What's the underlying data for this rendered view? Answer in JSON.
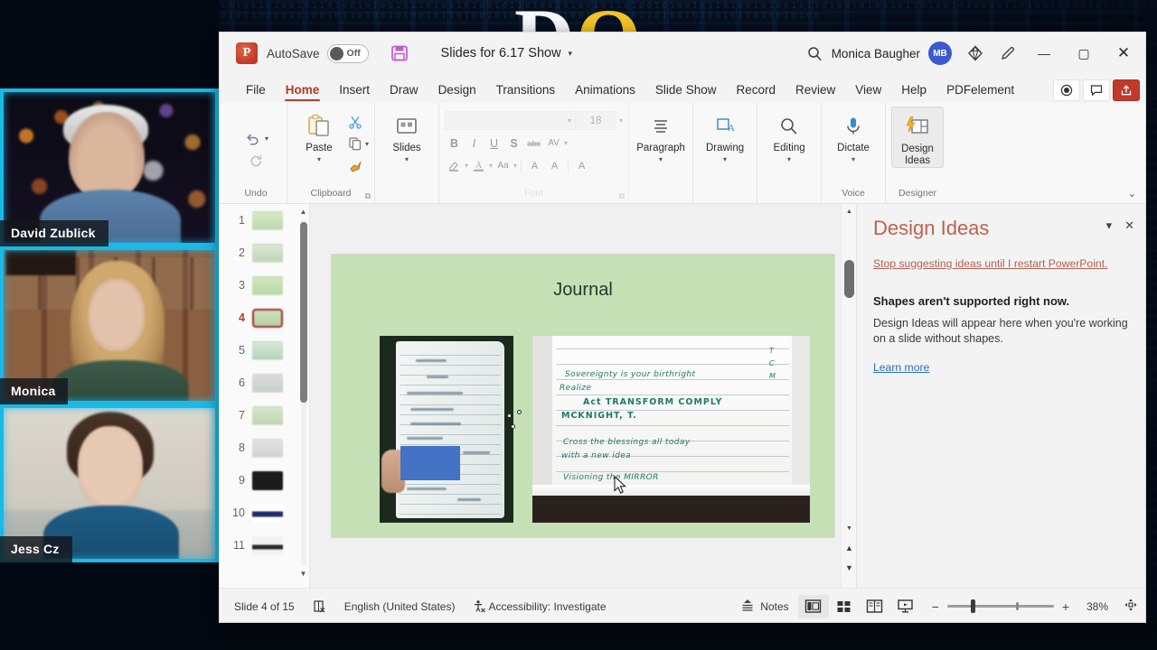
{
  "desktop": {
    "background_title_white": "D",
    "background_title_yellow": "O",
    "matrix_glyphs": "10110100101001011010010100101101001010010110100101001011010010100101101001010010110100101001011010010100101101001010010110100101001011010010100101101001010010110100101001011010010100101101001010010110100101001011010010100101101001010010110100101001011010010100"
  },
  "video_call": {
    "participants": [
      {
        "name": "David Zublick"
      },
      {
        "name": "Monica"
      },
      {
        "name": "Jess Cz"
      }
    ]
  },
  "titlebar": {
    "app_logo_letter": "P",
    "autosave_label": "AutoSave",
    "autosave_state": "Off",
    "save_icon": "save-icon",
    "document_title": "Slides for 6.17 Show",
    "title_caret": "▾",
    "search_icon": "search-icon",
    "user_name": "Monica Baugher",
    "user_initials": "MB",
    "diamond_icon": "diamond-icon",
    "pen_icon": "pen-icon",
    "minimize": "—",
    "maximize": "▢",
    "close": "✕"
  },
  "tabs": [
    {
      "label": "File",
      "active": false
    },
    {
      "label": "Home",
      "active": true
    },
    {
      "label": "Insert",
      "active": false
    },
    {
      "label": "Draw",
      "active": false
    },
    {
      "label": "Design",
      "active": false
    },
    {
      "label": "Transitions",
      "active": false
    },
    {
      "label": "Animations",
      "active": false
    },
    {
      "label": "Slide Show",
      "active": false
    },
    {
      "label": "Record",
      "active": false
    },
    {
      "label": "Review",
      "active": false
    },
    {
      "label": "View",
      "active": false
    },
    {
      "label": "Help",
      "active": false
    },
    {
      "label": "PDFelement",
      "active": false
    }
  ],
  "tabrow_right": {
    "record_icon": "record-circle-icon",
    "comments_icon": "comment-icon",
    "share_icon": "share-icon"
  },
  "ribbon": {
    "undo": {
      "group_label": "Undo",
      "undo_icon": "undo-arrow-icon",
      "redo_icon": "redo-arrow-icon",
      "caret": "▾"
    },
    "clipboard": {
      "group_label": "Clipboard",
      "paste_label": "Paste",
      "paste_icon": "clipboard-icon",
      "cut_icon": "scissors-icon",
      "copy_icon": "copy-icon",
      "format_painter_icon": "format-painter-icon",
      "caret": "▾",
      "launcher": "⧉"
    },
    "slides": {
      "group_label": "",
      "label": "Slides",
      "icon": "new-slide-icon",
      "caret": "▾"
    },
    "font": {
      "group_label": "Font",
      "font_name_value": "",
      "font_name_placeholder": "",
      "font_size_value": "18",
      "bold": "B",
      "italic": "I",
      "underline": "U",
      "shadow": "S",
      "strikethrough": "abc",
      "char_spacing": "AV",
      "text_highlight_icon": "highlight-icon",
      "font_color_icon": "font-color-icon",
      "change_case": "Aa",
      "increase_size": "A",
      "decrease_size": "A",
      "clear_formatting": "A",
      "caret": "▾",
      "launcher": "⧉"
    },
    "paragraph": {
      "label": "Paragraph",
      "icon": "paragraph-lines-icon",
      "caret": "▾"
    },
    "drawing": {
      "label": "Drawing",
      "icon": "shapes-icon",
      "caret": "▾"
    },
    "editing": {
      "label": "Editing",
      "icon": "find-icon",
      "caret": "▾"
    },
    "voice": {
      "group_label": "Voice",
      "label": "Dictate",
      "icon": "microphone-icon",
      "caret": "▾"
    },
    "designer": {
      "group_label": "Designer",
      "label_line1": "Design",
      "label_line2": "Ideas",
      "icon": "design-ideas-icon"
    },
    "collapse_caret": "⌄"
  },
  "thumbnails": {
    "selected": 4,
    "slides": [
      {
        "number": "1"
      },
      {
        "number": "2"
      },
      {
        "number": "3"
      },
      {
        "number": "4"
      },
      {
        "number": "5"
      },
      {
        "number": "6"
      },
      {
        "number": "7"
      },
      {
        "number": "8"
      },
      {
        "number": "9"
      },
      {
        "number": "10"
      },
      {
        "number": "11"
      }
    ],
    "scroll_up": "▲",
    "scroll_down": "▼"
  },
  "slide": {
    "title": "Journal",
    "background_color": "#c5e0b4",
    "shape_color": "#4472c4",
    "right_photo_handwriting": [
      "Sovereignty is your birthright",
      "Realize",
      "Act  TRANSFORM  COMPLY",
      "MCKNIGHT,  T.",
      "Cross the blessings all  today",
      "with a new idea",
      "Visioning the MIRROR"
    ],
    "right_photo_margin_notes": [
      "T",
      "C",
      "M"
    ]
  },
  "design_pane": {
    "title": "Design Ideas",
    "caret": "▾",
    "close": "✕",
    "stop_link": "Stop suggesting ideas until I restart PowerPoint.",
    "headline": "Shapes aren't supported right now.",
    "body": "Design Ideas will appear here when you're working on a slide without shapes.",
    "learn_more": "Learn more"
  },
  "canvas_scroll": {
    "up_arrow": "▲",
    "down_arrow": "▼",
    "prev_slide": "▲",
    "next_slide": "▼"
  },
  "statusbar": {
    "slide_counter": "Slide 4 of 15",
    "spellcheck_icon": "spellcheck-icon",
    "language": "English (United States)",
    "accessibility_icon": "accessibility-icon",
    "accessibility": "Accessibility: Investigate",
    "notes_label": "Notes",
    "notes_icon": "notes-icon",
    "view_normal_icon": "normal-view-icon",
    "view_sorter_icon": "slide-sorter-icon",
    "view_reading_icon": "reading-view-icon",
    "view_slideshow_icon": "slideshow-icon",
    "zoom_out": "−",
    "zoom_in": "+",
    "zoom_level": "38%",
    "fit_icon": "fit-to-window-icon"
  }
}
